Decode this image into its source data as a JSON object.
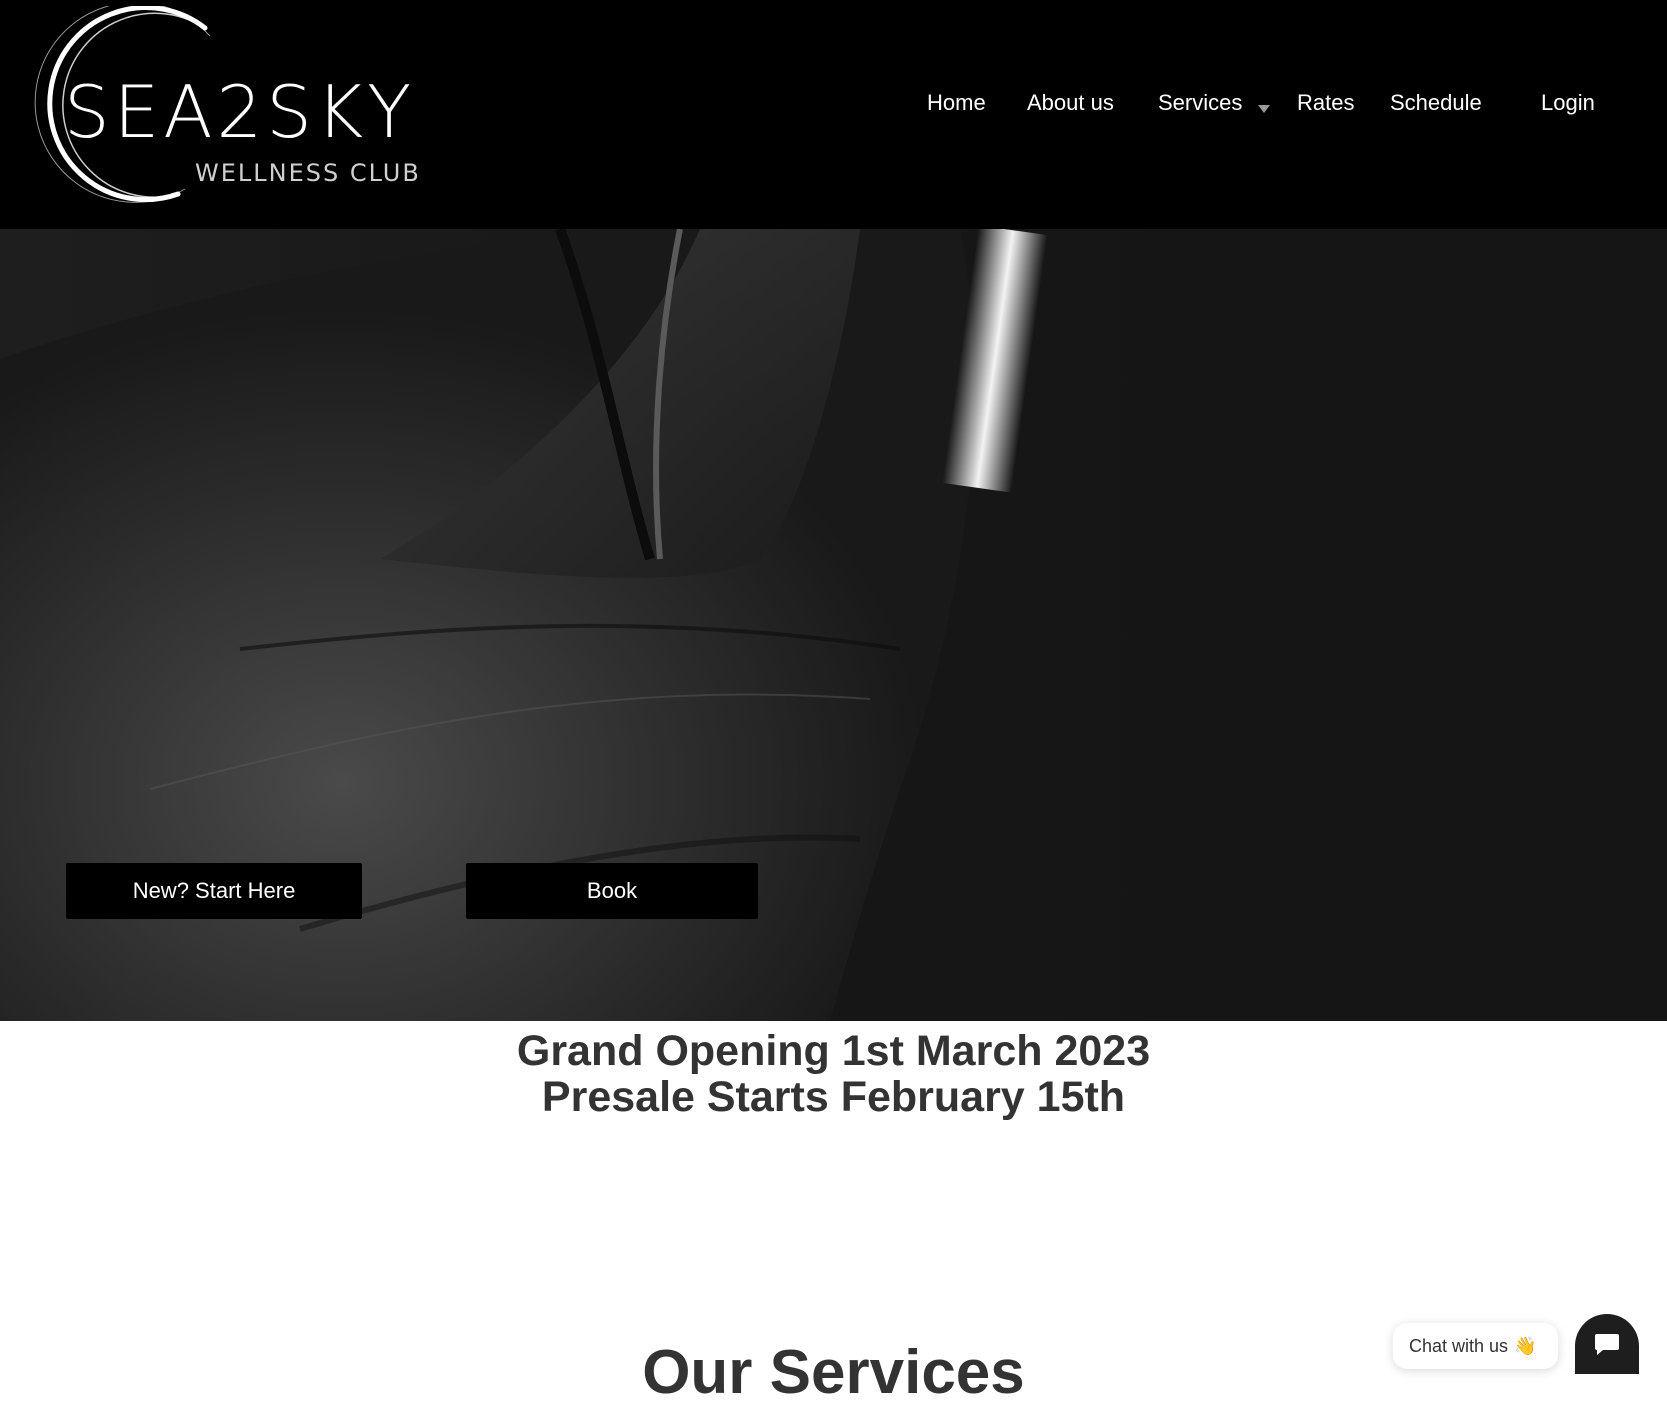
{
  "logo": {
    "brand": "SEA2SKY",
    "tagline": "WELLNESS CLUB"
  },
  "nav": {
    "items": [
      {
        "label": "Home"
      },
      {
        "label": "About us"
      },
      {
        "label": "Services"
      },
      {
        "label": "Rates"
      },
      {
        "label": "Schedule"
      },
      {
        "label": "Login"
      }
    ]
  },
  "hero": {
    "image": "boxing-glove-closeup-photo",
    "buttons": {
      "start": "New? Start Here",
      "book": "Book"
    }
  },
  "announcement": {
    "line1": "Grand Opening 1st March 2023",
    "line2": "Presale Starts February 15th"
  },
  "services": {
    "title": "Our Services"
  },
  "chat": {
    "label": "Chat with us",
    "emoji": "👋",
    "icon": "chat-bubble-icon"
  },
  "colors": {
    "header_bg": "#000000",
    "heading_text": "#333333",
    "button_bg": "#000000",
    "chat_button_bg": "#1e1e1e"
  }
}
